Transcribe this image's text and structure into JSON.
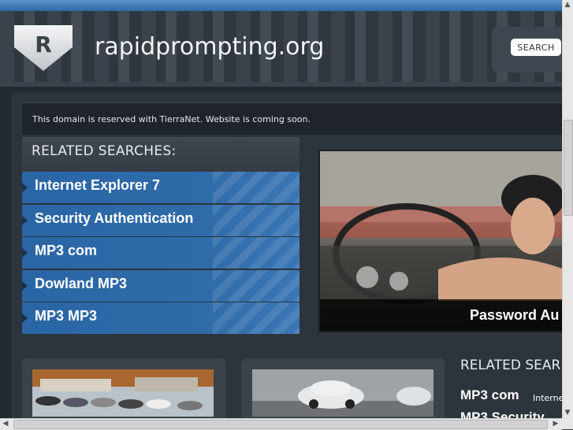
{
  "site": {
    "logo_letter": "R",
    "title": "rapidprompting.org"
  },
  "search": {
    "button_label": "SEARCH"
  },
  "notice": {
    "text": "This domain is reserved with TierraNet. Website is coming soon."
  },
  "related": {
    "heading": "RELATED SEARCHES:",
    "links": [
      {
        "label": "Internet Explorer 7"
      },
      {
        "label": "Security Authentication"
      },
      {
        "label": "MP3 com"
      },
      {
        "label": "Dowland MP3"
      },
      {
        "label": "MP3 MP3"
      }
    ]
  },
  "hero": {
    "caption": "Password Au"
  },
  "related_right": {
    "heading": "RELATED SEAR",
    "item1": "MP3 com",
    "item1_sub": "Interne",
    "item2": "MP3 Security"
  },
  "colors": {
    "link_blue": "#2f6aa8",
    "topbar_blue": "#3f7dbb",
    "page_dark": "#2c343c"
  },
  "icons": {
    "logo": "shield-r-icon",
    "scroll_up": "arrow-up-icon",
    "scroll_down": "arrow-down-icon",
    "scroll_left": "arrow-left-icon",
    "scroll_right": "arrow-right-icon"
  }
}
